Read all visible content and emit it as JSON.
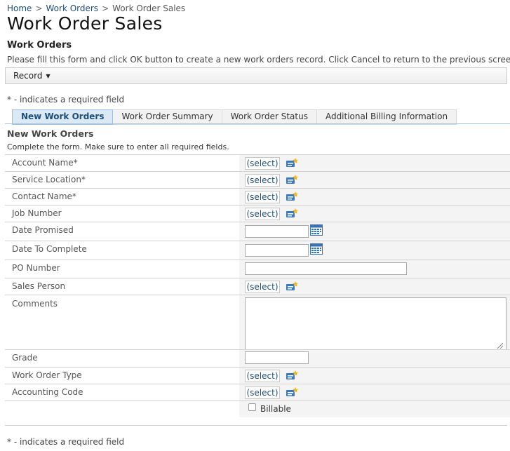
{
  "breadcrumb": {
    "home": "Home",
    "sep": ">",
    "work_orders": "Work Orders",
    "current": "Work Order Sales"
  },
  "page": {
    "title": "Work Order Sales",
    "section_title": "Work Orders",
    "instructions": "Please fill this form and click OK button to create a new work orders record. Click Cancel to return to the previous screen."
  },
  "toolbar": {
    "record_label": "Record"
  },
  "required_note": "* - indicates a required field",
  "tabs": [
    "New Work Orders",
    "Work Order Summary",
    "Work Order Status",
    "Additional Billing Information"
  ],
  "form": {
    "title": "New Work Orders",
    "description": "Complete the form. Make sure to enter all required fields.",
    "select_label": "(select)",
    "fields": {
      "account_name": "Account Name",
      "service_location": "Service Location",
      "contact_name": "Contact Name",
      "job_number": "Job Number",
      "date_promised": "Date Promised",
      "date_to_complete": "Date To Complete",
      "po_number": "PO Number",
      "sales_person": "Sales Person",
      "comments": "Comments",
      "grade": "Grade",
      "work_order_type": "Work Order Type",
      "accounting_code": "Accounting Code",
      "billable": "Billable"
    },
    "required_marker": "*"
  },
  "colors": {
    "link": "#1f4e79",
    "active_tab_bg": "#dbe9f5",
    "value_cell_bg": "#f4f4f4"
  }
}
